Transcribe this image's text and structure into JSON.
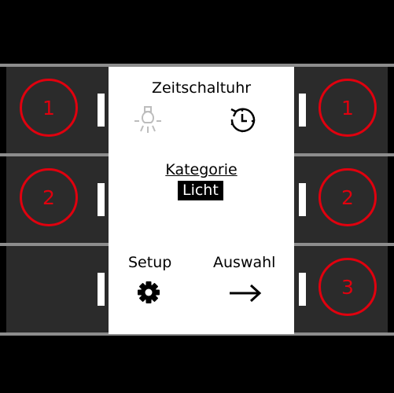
{
  "screen": {
    "title": "Zeitschaltuhr",
    "category_label": "Kategorie",
    "category_value": "Licht",
    "setup_label": "Setup",
    "auswahl_label": "Auswahl",
    "icons": [
      "light-bulb-icon",
      "timer-clock-icon",
      "gear-icon",
      "arrow-right-icon"
    ]
  },
  "buttons": {
    "left": [
      {
        "marker": "1"
      },
      {
        "marker": "2"
      },
      {
        "marker": ""
      }
    ],
    "right": [
      {
        "marker": "1"
      },
      {
        "marker": "2"
      },
      {
        "marker": "3"
      }
    ]
  },
  "colors": {
    "marker": "#e0000e",
    "button": "#2b2b2b",
    "screen": "#ffffff",
    "separator": "#8d8d8d"
  }
}
